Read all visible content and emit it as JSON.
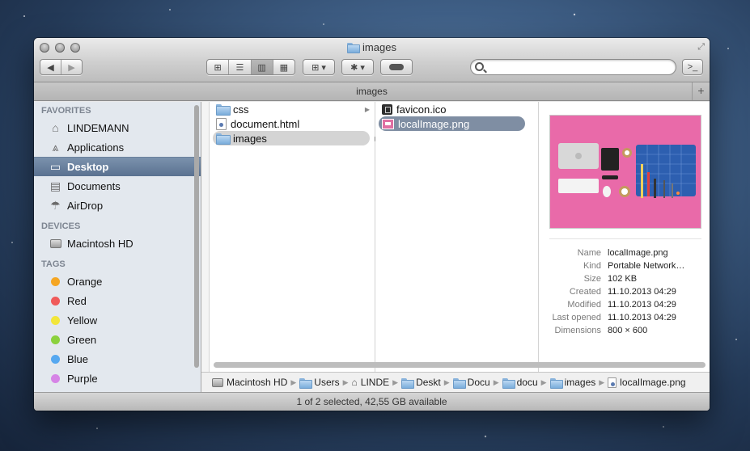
{
  "window": {
    "title": "images",
    "tab_title": "images",
    "status": "1 of 2 selected, 42,55 GB available"
  },
  "toolbar": {
    "back_icon": "back-arrow-icon",
    "forward_icon": "forward-arrow-icon",
    "view_modes": [
      "icon-view-icon",
      "list-view-icon",
      "column-view-icon",
      "coverflow-view-icon"
    ],
    "active_view": "column",
    "terminal_label": ">_"
  },
  "sidebar": {
    "favorites_header": "FAVORITES",
    "favorites": [
      {
        "label": "LINDEMANN",
        "icon": "home-icon"
      },
      {
        "label": "Applications",
        "icon": "applications-icon"
      },
      {
        "label": "Desktop",
        "icon": "desktop-icon",
        "selected": true
      },
      {
        "label": "Documents",
        "icon": "documents-icon"
      },
      {
        "label": "AirDrop",
        "icon": "airdrop-icon"
      }
    ],
    "devices_header": "DEVICES",
    "devices": [
      {
        "label": "Macintosh HD",
        "icon": "harddisk-icon"
      }
    ],
    "tags_header": "TAGS",
    "tags": [
      {
        "label": "Orange",
        "color": "#f5a623"
      },
      {
        "label": "Red",
        "color": "#f05a5a"
      },
      {
        "label": "Yellow",
        "color": "#f2e63a"
      },
      {
        "label": "Green",
        "color": "#8bd13d"
      },
      {
        "label": "Blue",
        "color": "#56a8f0"
      },
      {
        "label": "Purple",
        "color": "#d684e6"
      }
    ]
  },
  "columns": {
    "col1": [
      {
        "label": "css",
        "icon": "folder-icon"
      },
      {
        "label": "document.html",
        "icon": "html-file-icon"
      },
      {
        "label": "images",
        "icon": "folder-icon",
        "selected": true
      }
    ],
    "col2": [
      {
        "label": "favicon.ico",
        "icon": "ico-file-icon"
      },
      {
        "label": "localImage.png",
        "icon": "png-file-icon",
        "selected": true
      }
    ]
  },
  "preview": {
    "info": [
      {
        "key": "Name",
        "value": "localImage.png"
      },
      {
        "key": "Kind",
        "value": "Portable Network…"
      },
      {
        "key": "Size",
        "value": "102 KB"
      },
      {
        "key": "Created",
        "value": "11.10.2013 04:29"
      },
      {
        "key": "Modified",
        "value": "11.10.2013 04:29"
      },
      {
        "key": "Last opened",
        "value": "11.10.2013 04:29"
      },
      {
        "key": "Dimensions",
        "value": "800 × 600"
      }
    ]
  },
  "pathbar": [
    {
      "label": "Macintosh HD",
      "icon": "harddisk-icon"
    },
    {
      "label": "Users",
      "icon": "folder-icon"
    },
    {
      "label": "LINDE",
      "icon": "home-icon"
    },
    {
      "label": "Deskt",
      "icon": "folder-icon"
    },
    {
      "label": "Docu",
      "icon": "folder-icon"
    },
    {
      "label": "docu",
      "icon": "folder-icon"
    },
    {
      "label": "images",
      "icon": "folder-icon"
    },
    {
      "label": "localImage.png",
      "icon": "png-file-icon"
    }
  ]
}
